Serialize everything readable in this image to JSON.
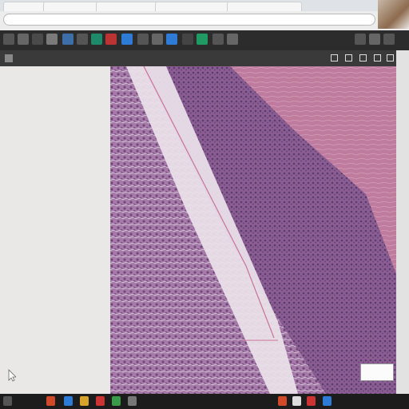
{
  "browser": {
    "tabs": [
      "",
      "",
      "",
      "",
      ""
    ],
    "address": ""
  },
  "toolbar": {
    "tools": [
      "tool-a",
      "tool-b",
      "tool-c",
      "tool-d",
      "tool-e",
      "tool-f",
      "tool-g",
      "tool-h",
      "tool-i",
      "tool-j",
      "tool-k",
      "tool-l",
      "tool-m",
      "tool-n",
      "tool-o",
      "tool-p"
    ],
    "accent": "#2e7bd6"
  },
  "viewer": {
    "title": "",
    "slide_label": ""
  },
  "colors": {
    "tissue_dark": "#7a4f86",
    "tissue_light": "#b88ab0",
    "stroma": "#c77f9f",
    "fibrous_band": "#e8dde6"
  },
  "taskbar": {
    "clock": ""
  }
}
